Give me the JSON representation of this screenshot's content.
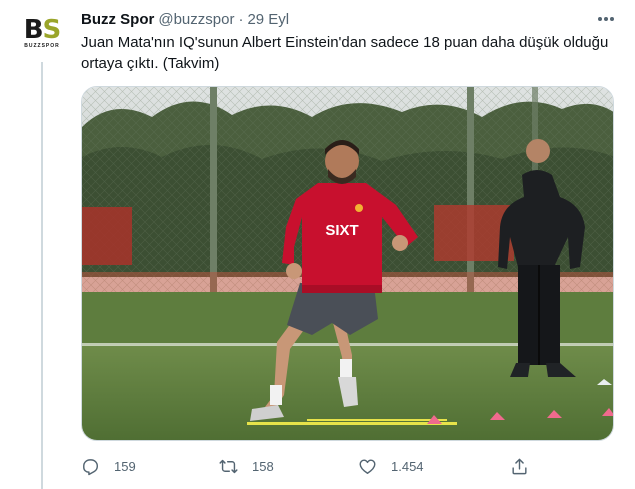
{
  "tweet": {
    "avatar": {
      "mark_left": "B",
      "mark_right": "S",
      "subtext": "BUZZSPOR"
    },
    "author_name": "Buzz Spor",
    "handle": "@buzzspor",
    "separator": "·",
    "time": "29 Eyl",
    "text": "Juan Mata'nın IQ'sunun Albert Einstein'dan sadece 18 puan daha düşük olduğu ortaya çıktı. (Takvim)",
    "media": {
      "description_icon": "photo",
      "jersey_sponsor": "SIXT"
    },
    "actions": {
      "reply_count": "159",
      "retweet_count": "158",
      "like_count": "1.454"
    }
  },
  "colors": {
    "text_primary": "#0f1419",
    "text_secondary": "#536471",
    "border": "#cfd9de",
    "brand_green": "#9aa52a",
    "jersey_red": "#c8102e"
  }
}
